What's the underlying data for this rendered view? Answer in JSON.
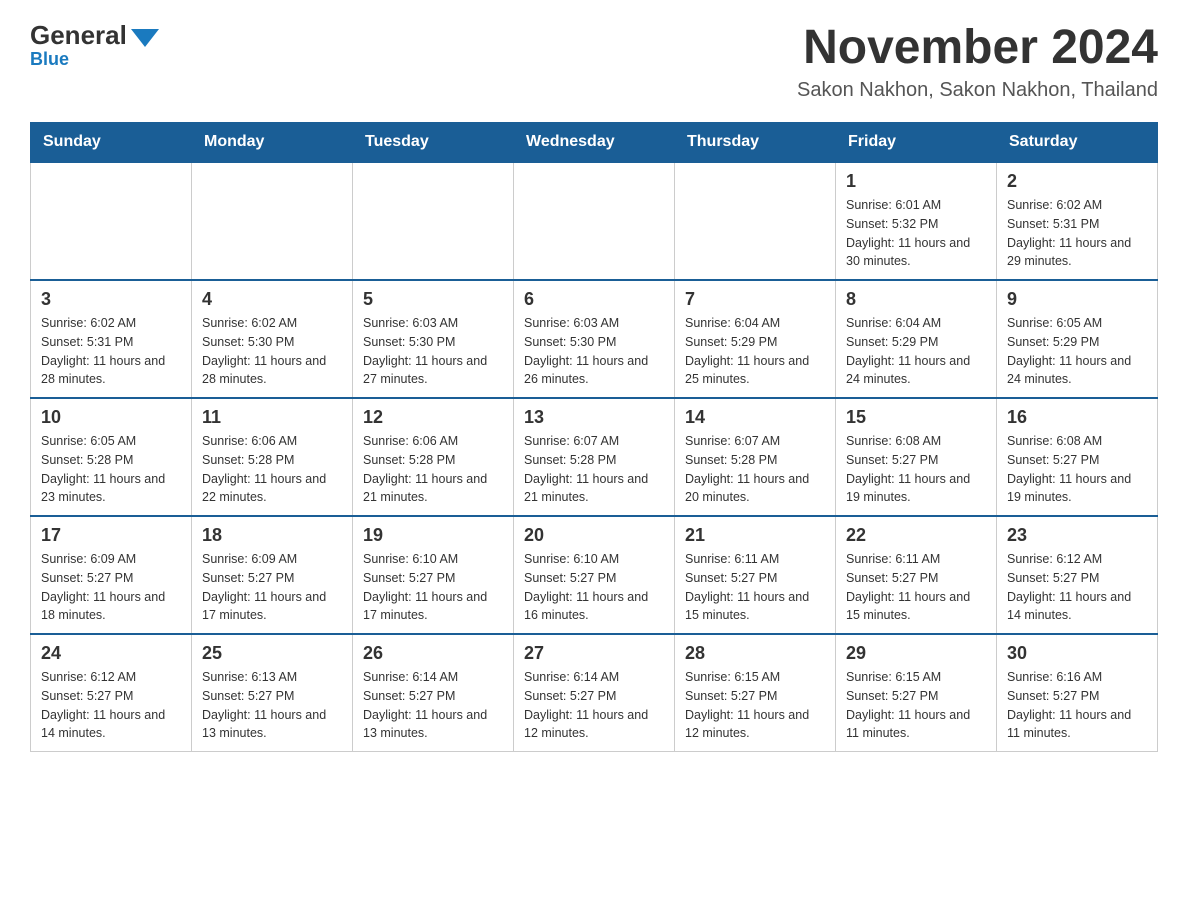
{
  "header": {
    "logo_main": "General",
    "logo_sub": "Blue",
    "title": "November 2024",
    "subtitle": "Sakon Nakhon, Sakon Nakhon, Thailand"
  },
  "days_of_week": [
    "Sunday",
    "Monday",
    "Tuesday",
    "Wednesday",
    "Thursday",
    "Friday",
    "Saturday"
  ],
  "weeks": [
    [
      {
        "day": "",
        "info": ""
      },
      {
        "day": "",
        "info": ""
      },
      {
        "day": "",
        "info": ""
      },
      {
        "day": "",
        "info": ""
      },
      {
        "day": "",
        "info": ""
      },
      {
        "day": "1",
        "info": "Sunrise: 6:01 AM\nSunset: 5:32 PM\nDaylight: 11 hours and 30 minutes."
      },
      {
        "day": "2",
        "info": "Sunrise: 6:02 AM\nSunset: 5:31 PM\nDaylight: 11 hours and 29 minutes."
      }
    ],
    [
      {
        "day": "3",
        "info": "Sunrise: 6:02 AM\nSunset: 5:31 PM\nDaylight: 11 hours and 28 minutes."
      },
      {
        "day": "4",
        "info": "Sunrise: 6:02 AM\nSunset: 5:30 PM\nDaylight: 11 hours and 28 minutes."
      },
      {
        "day": "5",
        "info": "Sunrise: 6:03 AM\nSunset: 5:30 PM\nDaylight: 11 hours and 27 minutes."
      },
      {
        "day": "6",
        "info": "Sunrise: 6:03 AM\nSunset: 5:30 PM\nDaylight: 11 hours and 26 minutes."
      },
      {
        "day": "7",
        "info": "Sunrise: 6:04 AM\nSunset: 5:29 PM\nDaylight: 11 hours and 25 minutes."
      },
      {
        "day": "8",
        "info": "Sunrise: 6:04 AM\nSunset: 5:29 PM\nDaylight: 11 hours and 24 minutes."
      },
      {
        "day": "9",
        "info": "Sunrise: 6:05 AM\nSunset: 5:29 PM\nDaylight: 11 hours and 24 minutes."
      }
    ],
    [
      {
        "day": "10",
        "info": "Sunrise: 6:05 AM\nSunset: 5:28 PM\nDaylight: 11 hours and 23 minutes."
      },
      {
        "day": "11",
        "info": "Sunrise: 6:06 AM\nSunset: 5:28 PM\nDaylight: 11 hours and 22 minutes."
      },
      {
        "day": "12",
        "info": "Sunrise: 6:06 AM\nSunset: 5:28 PM\nDaylight: 11 hours and 21 minutes."
      },
      {
        "day": "13",
        "info": "Sunrise: 6:07 AM\nSunset: 5:28 PM\nDaylight: 11 hours and 21 minutes."
      },
      {
        "day": "14",
        "info": "Sunrise: 6:07 AM\nSunset: 5:28 PM\nDaylight: 11 hours and 20 minutes."
      },
      {
        "day": "15",
        "info": "Sunrise: 6:08 AM\nSunset: 5:27 PM\nDaylight: 11 hours and 19 minutes."
      },
      {
        "day": "16",
        "info": "Sunrise: 6:08 AM\nSunset: 5:27 PM\nDaylight: 11 hours and 19 minutes."
      }
    ],
    [
      {
        "day": "17",
        "info": "Sunrise: 6:09 AM\nSunset: 5:27 PM\nDaylight: 11 hours and 18 minutes."
      },
      {
        "day": "18",
        "info": "Sunrise: 6:09 AM\nSunset: 5:27 PM\nDaylight: 11 hours and 17 minutes."
      },
      {
        "day": "19",
        "info": "Sunrise: 6:10 AM\nSunset: 5:27 PM\nDaylight: 11 hours and 17 minutes."
      },
      {
        "day": "20",
        "info": "Sunrise: 6:10 AM\nSunset: 5:27 PM\nDaylight: 11 hours and 16 minutes."
      },
      {
        "day": "21",
        "info": "Sunrise: 6:11 AM\nSunset: 5:27 PM\nDaylight: 11 hours and 15 minutes."
      },
      {
        "day": "22",
        "info": "Sunrise: 6:11 AM\nSunset: 5:27 PM\nDaylight: 11 hours and 15 minutes."
      },
      {
        "day": "23",
        "info": "Sunrise: 6:12 AM\nSunset: 5:27 PM\nDaylight: 11 hours and 14 minutes."
      }
    ],
    [
      {
        "day": "24",
        "info": "Sunrise: 6:12 AM\nSunset: 5:27 PM\nDaylight: 11 hours and 14 minutes."
      },
      {
        "day": "25",
        "info": "Sunrise: 6:13 AM\nSunset: 5:27 PM\nDaylight: 11 hours and 13 minutes."
      },
      {
        "day": "26",
        "info": "Sunrise: 6:14 AM\nSunset: 5:27 PM\nDaylight: 11 hours and 13 minutes."
      },
      {
        "day": "27",
        "info": "Sunrise: 6:14 AM\nSunset: 5:27 PM\nDaylight: 11 hours and 12 minutes."
      },
      {
        "day": "28",
        "info": "Sunrise: 6:15 AM\nSunset: 5:27 PM\nDaylight: 11 hours and 12 minutes."
      },
      {
        "day": "29",
        "info": "Sunrise: 6:15 AM\nSunset: 5:27 PM\nDaylight: 11 hours and 11 minutes."
      },
      {
        "day": "30",
        "info": "Sunrise: 6:16 AM\nSunset: 5:27 PM\nDaylight: 11 hours and 11 minutes."
      }
    ]
  ]
}
